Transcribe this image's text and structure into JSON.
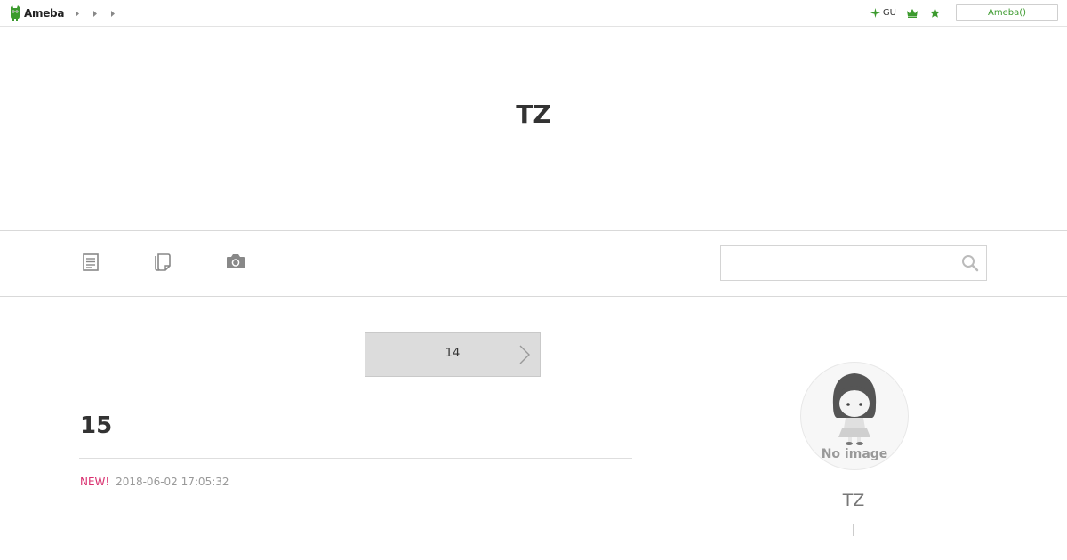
{
  "app": {
    "logo_text": "Ameba",
    "brand_color": "#3c9a2e"
  },
  "topbar": {
    "gu_label": "GU",
    "ameba_button_label": "Ameba()"
  },
  "blog": {
    "title": "TZ"
  },
  "nav": {
    "items": [
      {
        "icon": "document-icon"
      },
      {
        "icon": "copy-icon"
      },
      {
        "icon": "camera-icon"
      }
    ],
    "search_value": ""
  },
  "pager": {
    "label": "14"
  },
  "entry": {
    "title": "15",
    "new_label": "NEW!",
    "date": "2018-06-02 17:05:32",
    "new_color": "#d9306f"
  },
  "profile": {
    "avatar_caption": "No image",
    "name": "TZ"
  }
}
